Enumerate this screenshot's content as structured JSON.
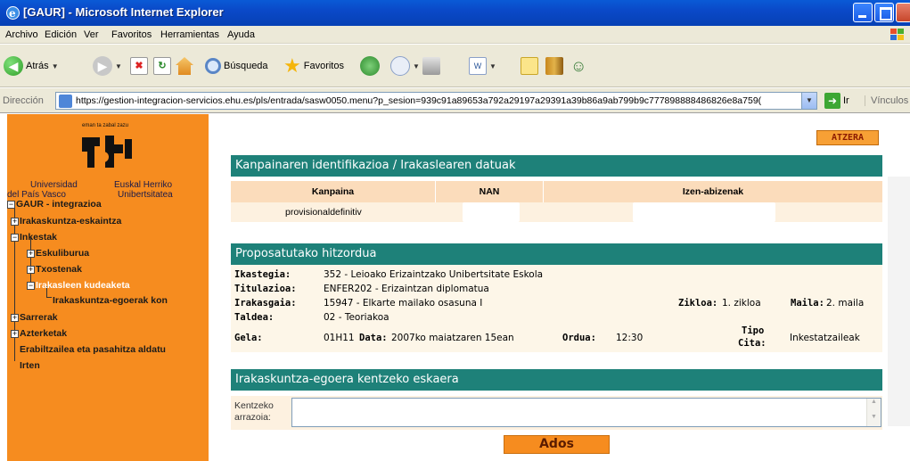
{
  "window": {
    "title": "[GAUR] - Microsoft Internet Explorer"
  },
  "menubar": [
    "Archivo",
    "Edición",
    "Ver",
    "Favoritos",
    "Herramientas",
    "Ayuda"
  ],
  "toolbar": {
    "back": "Atrás",
    "search": "Búsqueda",
    "favorites": "Favoritos"
  },
  "address": {
    "label": "Dirección",
    "url": "https://gestion-integracion-servicios.ehu.es/pls/entrada/sasw0050.menu?p_sesion=939c91a89653a792a29197a29391a39b86a9ab799b9c777898888486826e8a759(",
    "go": "Ir",
    "links": "Vínculos"
  },
  "sidebar": {
    "logo_text": "eman ta zabal zazu",
    "univ_left": [
      "Universidad",
      "del País Vasco"
    ],
    "univ_right": [
      "Euskal Herriko",
      "Unibertsitatea"
    ],
    "tree": {
      "root": "GAUR - integrazioa",
      "irakaskuntza_eskaintza": "Irakaskuntza-eskaintza",
      "inkestak": "Inkestak",
      "eskuliburua": "Eskuliburua",
      "txostenak": "Txostenak",
      "irakasleen_kudeaketa": "Irakasleen kudeaketa",
      "irakaskuntza_egoerak": "Irakaskuntza-egoerak kon",
      "sarrerak": "Sarrerak",
      "azterketak": "Azterketak",
      "erabiltzailea": "Erabiltzailea eta pasahitza aldatu",
      "irten": "Irten"
    }
  },
  "main": {
    "atzera": "ATZERA",
    "section1": {
      "title": "Kanpainaren identifikazioa / Irakaslearen datuak",
      "columns": [
        "Kanpaina",
        "NAN",
        "Izen-abizenak"
      ],
      "row": {
        "kanpaina": "provisionaldefinitiv"
      }
    },
    "section2": {
      "title": "Proposatutako hitzordua",
      "labels": {
        "ikastegia": "Ikastegia:",
        "titulazioa": "Titulazioa:",
        "irakasgaia": "Irakasgaia:",
        "taldea": "Taldea:",
        "gela": "Gela:",
        "zikloa": "Zikloa:",
        "maila": "Maila:",
        "data": "Data:",
        "ordua": "Ordua:",
        "tipo_cita_1": "Tipo",
        "tipo_cita_2": "Cita:"
      },
      "values": {
        "ikastegia": "352 - Leioako Erizaintzako Unibertsitate Eskola",
        "titulazioa": "ENFER202 - Erizaintzan diplomatua",
        "irakasgaia": "15947 - Elkarte mailako osasuna I",
        "taldea": "02 - Teoriakoa",
        "gela": "01H11",
        "zikloa": "1. zikloa",
        "maila": "2. maila",
        "data": "2007ko maiatzaren 15ean",
        "ordua": "12:30",
        "tipo_cita": "Inkestatzaileak"
      }
    },
    "section3": {
      "title": "Irakaskuntza-egoera kentzeko eskaera",
      "field_label_1": "Kentzeko",
      "field_label_2": "arrazoia:",
      "field_value": ""
    },
    "ados": "Ados"
  }
}
